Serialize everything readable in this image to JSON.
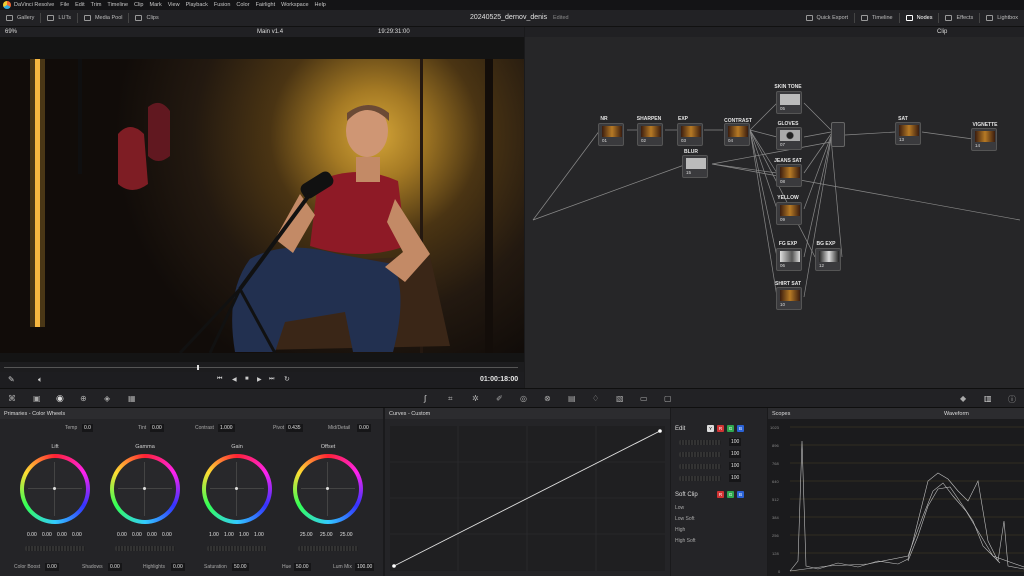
{
  "menubar": {
    "app": "DaVinci Resolve",
    "items": [
      "File",
      "Edit",
      "Trim",
      "Timeline",
      "Clip",
      "Mark",
      "View",
      "Playback",
      "Fusion",
      "Color",
      "Fairlight",
      "Workspace",
      "Help"
    ]
  },
  "toolbar": {
    "left": [
      "Gallery",
      "LUTs",
      "Media Pool",
      "Clips"
    ],
    "title": "20240525_dernov_denis",
    "status": "Edited",
    "right": [
      "Quick Export",
      "Timeline",
      "Nodes",
      "Effects",
      "Lightbox"
    ]
  },
  "viewer": {
    "zoom": "69%",
    "timeline": "Main v1.4",
    "timecode_top": "19:29:31:00",
    "timecode": "01:00:18:00"
  },
  "nodes": {
    "mode": "Clip",
    "items": [
      {
        "label": "NR",
        "num": "01"
      },
      {
        "label": "SHARPEN",
        "num": "02"
      },
      {
        "label": "EXP",
        "num": "03"
      },
      {
        "label": "CONTRAST",
        "num": "04"
      },
      {
        "label": "SKIN TONE",
        "num": "05"
      },
      {
        "label": "GLOVES",
        "num": "07"
      },
      {
        "label": "JEANS SAT",
        "num": "08"
      },
      {
        "label": "YELLOW",
        "num": "09"
      },
      {
        "label": "FG EXP",
        "num": "06"
      },
      {
        "label": "BG EXP",
        "num": "12"
      },
      {
        "label": "SHIRT SAT",
        "num": "10"
      },
      {
        "label": "SAT",
        "num": "13"
      },
      {
        "label": "VIGNETTE",
        "num": "14"
      },
      {
        "label": "BLUR",
        "num": "15"
      }
    ]
  },
  "primaries": {
    "title": "Primaries - Color Wheels",
    "top": [
      {
        "label": "Temp",
        "value": "0.0"
      },
      {
        "label": "Tint",
        "value": "0.00"
      },
      {
        "label": "Contrast",
        "value": "1.000"
      },
      {
        "label": "Pivot",
        "value": "0.435"
      },
      {
        "label": "Mid/Detail",
        "value": "0.00"
      }
    ],
    "wheels": [
      {
        "label": "Lift",
        "values": [
          "0.00",
          "0.00",
          "0.00",
          "0.00"
        ]
      },
      {
        "label": "Gamma",
        "values": [
          "0.00",
          "0.00",
          "0.00",
          "0.00"
        ]
      },
      {
        "label": "Gain",
        "values": [
          "1.00",
          "1.00",
          "1.00",
          "1.00"
        ]
      },
      {
        "label": "Offset",
        "values": [
          "25.00",
          "25.00",
          "25.00"
        ]
      }
    ],
    "bottom": [
      {
        "label": "Color Boost",
        "value": "0.00"
      },
      {
        "label": "Shadows",
        "value": "0.00"
      },
      {
        "label": "Highlights",
        "value": "0.00"
      },
      {
        "label": "Saturation",
        "value": "50.00"
      },
      {
        "label": "Hue",
        "value": "50.00"
      },
      {
        "label": "Lum Mix",
        "value": "100.00"
      }
    ]
  },
  "curves": {
    "title": "Curves - Custom"
  },
  "edit": {
    "title": "Edit",
    "channels": [
      "Y",
      "R",
      "G",
      "B"
    ],
    "values": [
      "100",
      "100",
      "100",
      "100"
    ],
    "soft_clip": "Soft Clip",
    "soft_rows": [
      "Low",
      "Low Soft",
      "High",
      "High Soft"
    ]
  },
  "scopes": {
    "title": "Scopes",
    "mode": "Waveform",
    "ticks": [
      "1023",
      "896",
      "768",
      "640",
      "512",
      "384",
      "256",
      "128",
      "0"
    ]
  },
  "colors": {
    "accent": "#e8b53a",
    "red": "#d23333",
    "green": "#2fa84f",
    "blue": "#2a62d6"
  }
}
